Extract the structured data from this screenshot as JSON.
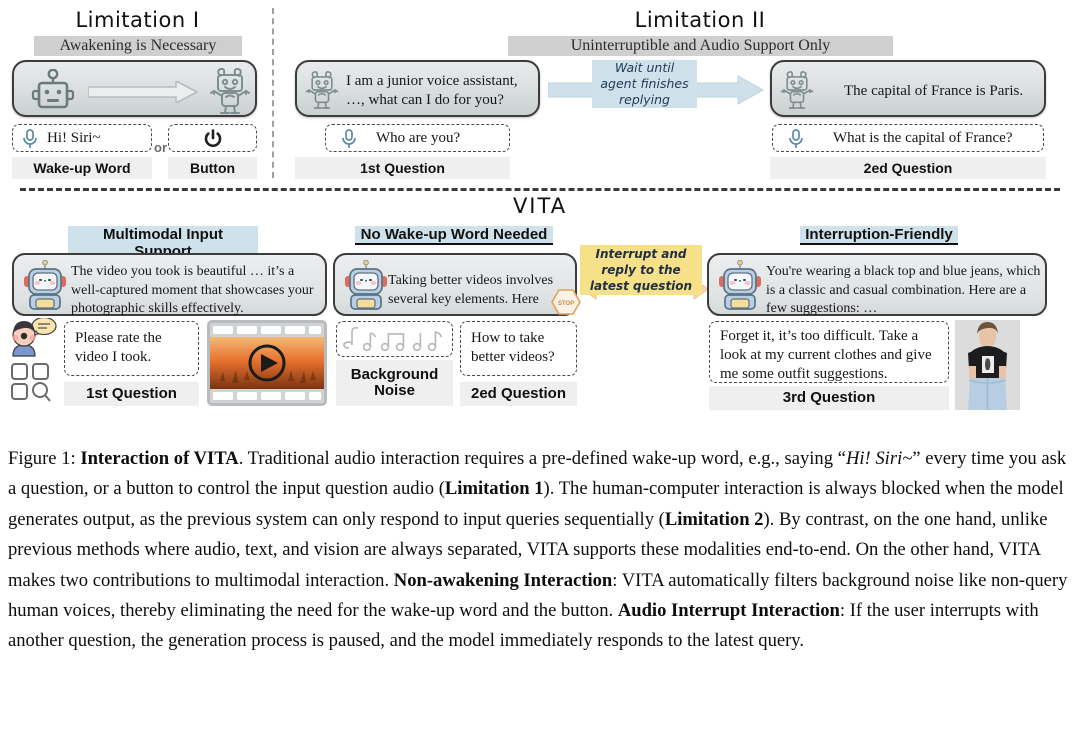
{
  "top": {
    "limitation1": {
      "title": "Limitation I",
      "subtitle": "Awakening is Necessary",
      "wake_word_text": "Hi! Siri~",
      "or_label": "or",
      "wake_word_chip": "Wake-up Word",
      "button_chip": "Button",
      "robot_sleep_icon": "robot-sleeping-icon",
      "robot_awake_icon": "robot-awake-icon",
      "mic_icon": "microphone-icon",
      "power_icon": "power-button-icon",
      "arrow_icon": "arrow-right-icon"
    },
    "limitation2": {
      "title": "Limitation II",
      "subtitle": "Uninterruptible and Audio Support Only",
      "reply1": "I am a junior voice assistant, …, what can I do for you?",
      "question1": "Who are you?",
      "question1_chip": "1st Question",
      "flow_note": "Wait until agent finishes replying",
      "reply2": "The capital of France is Paris.",
      "question2": "What is the capital of France?",
      "question2_chip": "2ed Question"
    }
  },
  "vita": {
    "title": "VITA",
    "features": [
      {
        "label": "Multimodal Input Support"
      },
      {
        "label": "No Wake-up Word Needed"
      },
      {
        "label": "Interruption-Friendly"
      }
    ],
    "panel1": {
      "reply": "The video you took is beautiful … it’s a well-captured moment that showcases your photographic skills effectively.",
      "question": "Please rate the video I took.",
      "chip": "1st Question",
      "user_icon": "user-speech-bubble-icon",
      "grid_icon": "grid-search-icon",
      "media_icon": "video-filmstrip-play-icon"
    },
    "panel2": {
      "reply": "Taking better videos involves several key elements. Here",
      "stop_badge": "STOP",
      "noise_icon": "music-notes-icon",
      "noise_chip": "Background Noise",
      "question": "How to take better videos?",
      "chip": "2ed Question"
    },
    "interrupt_note": "Interrupt and reply to the latest question",
    "panel3": {
      "reply": "You're wearing a black top and blue jeans, which is a classic and casual combination. Here are a few suggestions:  …",
      "question": "Forget it, it’s too difficult. Take a look at my current clothes and give me some outfit suggestions.",
      "chip": "3rd Question",
      "photo_icon": "person-outfit-photo"
    }
  },
  "caption": {
    "label": "Figure 1:",
    "bold_title": "Interaction of VITA",
    "p1": ". Traditional audio interaction requires a pre-defined wake-up word, e.g., saying “",
    "siri": "Hi!  Siri~",
    "p2": "” every time you ask a question, or a button to control the input question audio (",
    "lim1": "Limitation 1",
    "p3": "). The human-computer interaction is always blocked when the model generates output, as the previous system can only respond to input queries sequentially (",
    "lim2": "Limitation 2",
    "p4": "). By contrast, on the one hand, unlike previous methods where audio, text, and vision are always separated, VITA supports these modalities end-to-end. On the other hand, VITA makes two contributions to multimodal interaction. ",
    "nonawake": "Non-awakening Interaction",
    "p5": ": VITA automatically filters background noise like non-query human voices, thereby eliminating the need for the wake-up word and the button. ",
    "interrupt": "Audio Interrupt Interaction",
    "p6": ": If the user interrupts with another question, the generation process is paused, and the model immediately responds to the latest query."
  },
  "colors": {
    "panel_border": "#3c3c3c",
    "highlight_blue": "#cfe1ea",
    "highlight_yellow": "#f7e08a",
    "arrow_orange": "#f6c9a0",
    "chip_grey": "#efefef"
  }
}
